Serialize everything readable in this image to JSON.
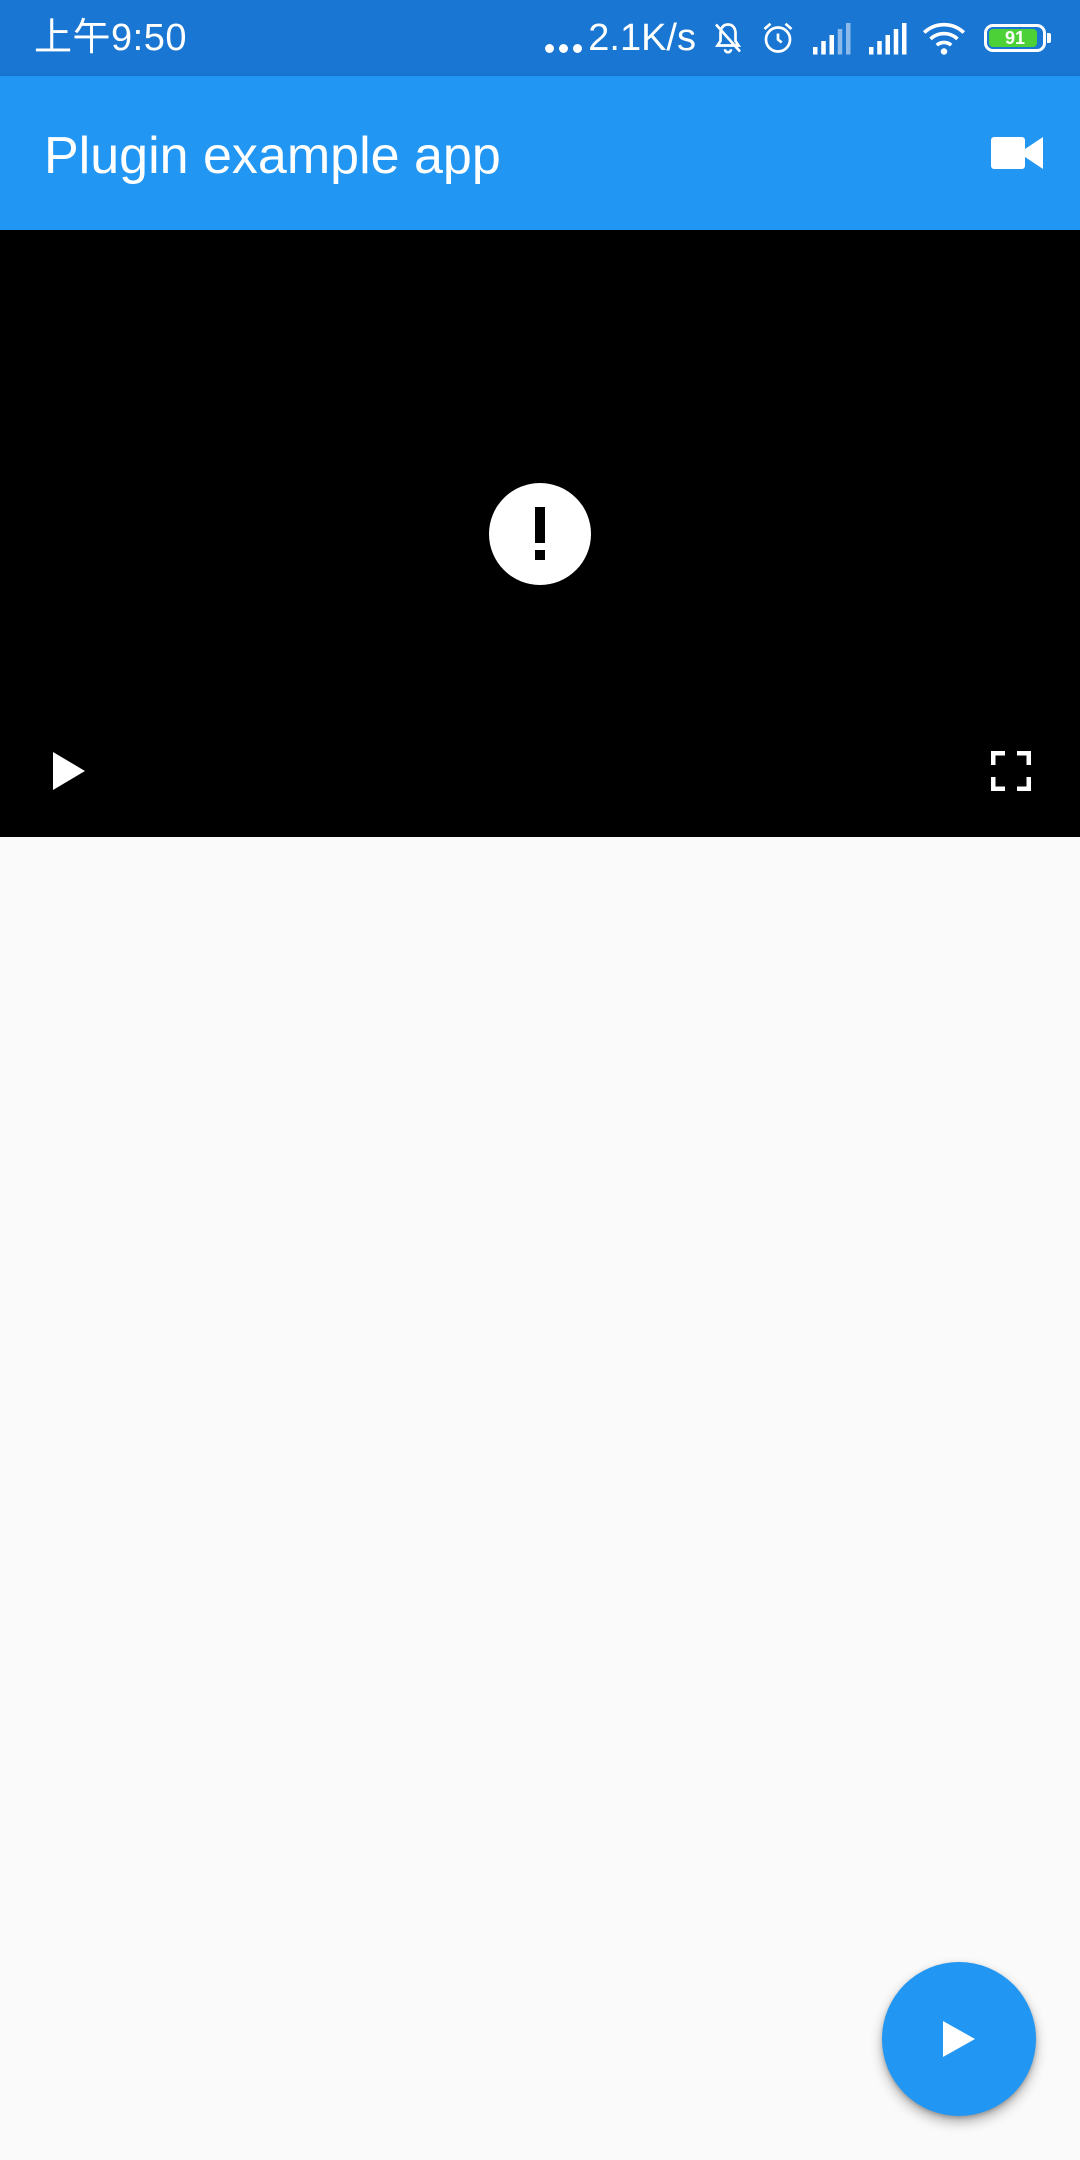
{
  "status_bar": {
    "time": "上午9:50",
    "network_speed": "2.1K/s",
    "battery_level": "91",
    "background_color": "#1976d2",
    "icons": [
      "more-dots-icon",
      "mute-bell-icon",
      "alarm-icon",
      "signal-icon",
      "signal-icon",
      "wifi-icon",
      "battery-icon"
    ]
  },
  "app_bar": {
    "title": "Plugin example app",
    "action_icon": "videocam-icon",
    "color": "#2196f3"
  },
  "video_player": {
    "state_icon": "error-icon",
    "controls": {
      "play_icon": "play-icon",
      "fullscreen_icon": "fullscreen-icon"
    },
    "background_color": "#000000"
  },
  "fab": {
    "icon": "play-icon",
    "color": "#2196f3"
  }
}
